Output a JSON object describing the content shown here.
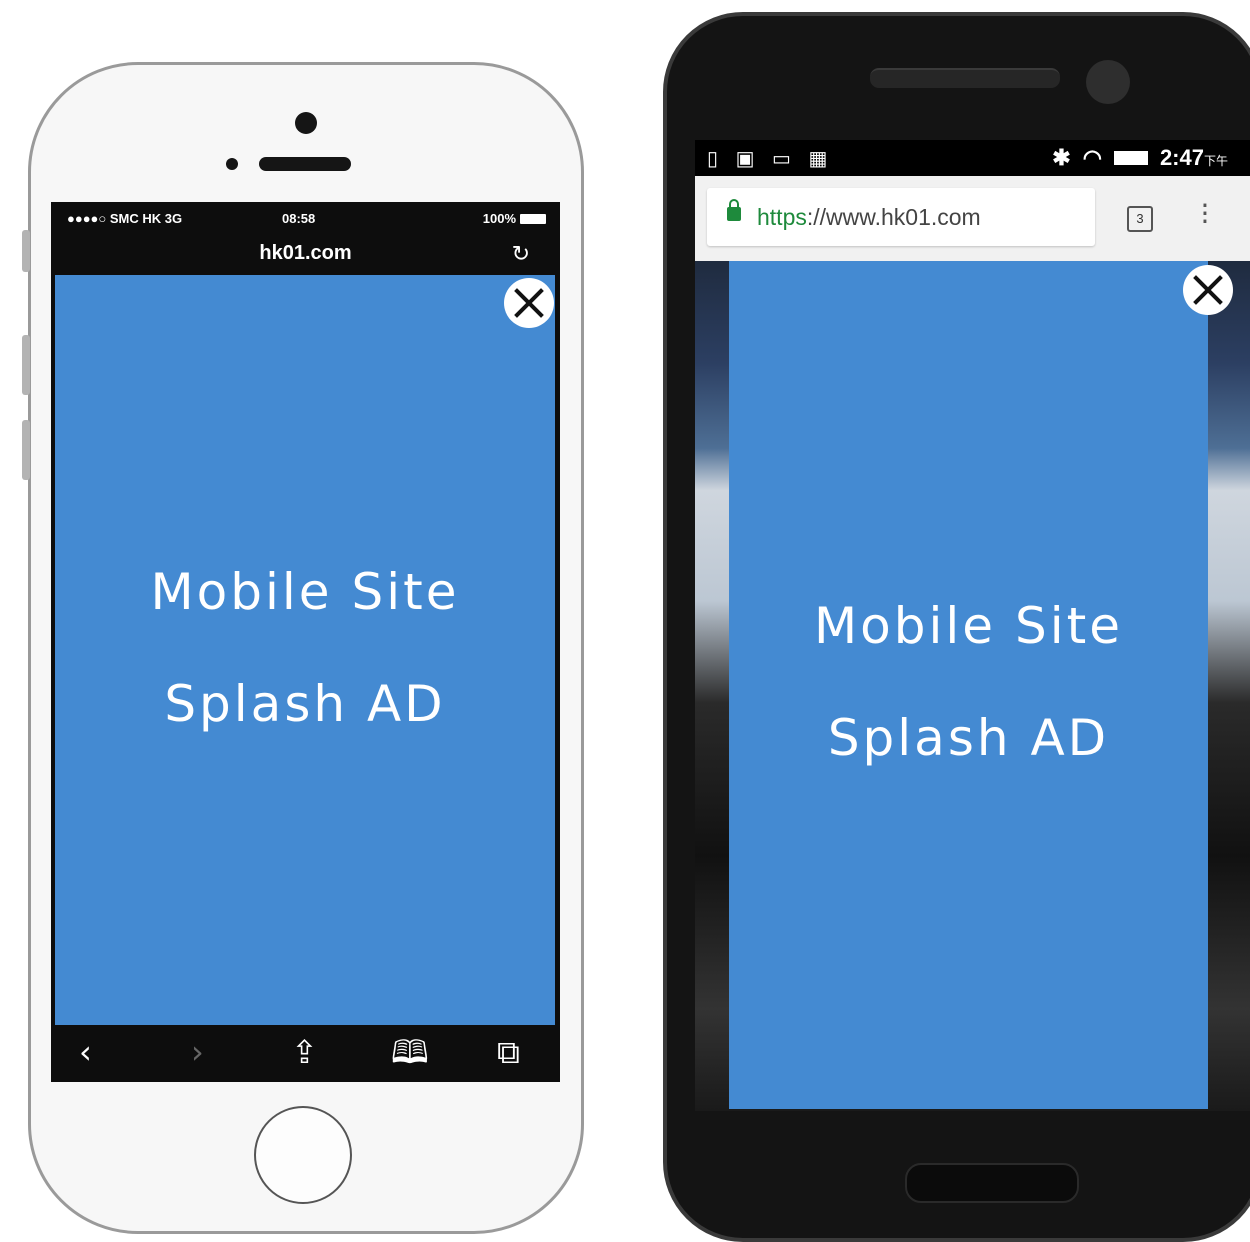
{
  "ios": {
    "status": {
      "carrier": "●●●●○ SMC HK  3G",
      "time": "08:58",
      "battery": "100%"
    },
    "url": "hk01.com",
    "reload_icon": "reload-icon",
    "ad_line1": "Mobile Site",
    "ad_line2": "Splash AD",
    "toolbar": {
      "back": "‹",
      "forward": "›",
      "share": "⇪",
      "bookmarks": "🕮",
      "tabs": "⧉"
    }
  },
  "android": {
    "status": {
      "left_icons": "▯ ▣ ▭ ▦",
      "time": "2:47",
      "ampm": "下午"
    },
    "url_scheme": "https",
    "url_rest": "://www.hk01.com",
    "tabs_count": "3",
    "ad_line1": "Mobile Site",
    "ad_line2": "Splash AD"
  },
  "colors": {
    "ad_background": "#448ad2",
    "secure_green": "#1e8a3c"
  }
}
